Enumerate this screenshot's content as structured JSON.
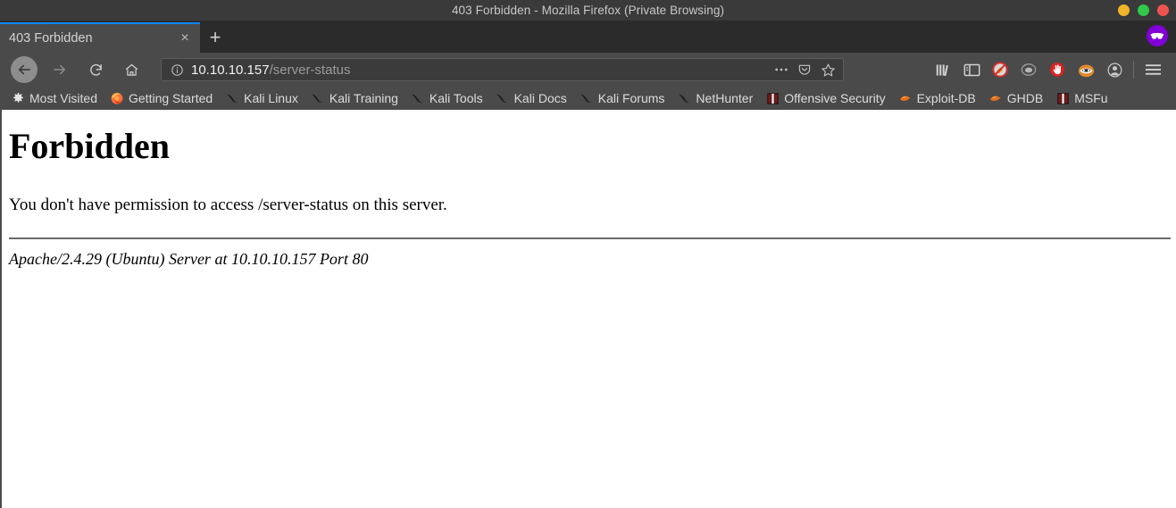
{
  "window": {
    "title": "403 Forbidden - Mozilla Firefox (Private Browsing)",
    "controls": [
      {
        "name": "minimize",
        "color": "#f0b429"
      },
      {
        "name": "maximize",
        "color": "#2fc84a"
      },
      {
        "name": "close",
        "color": "#ef5350"
      }
    ]
  },
  "tabbar": {
    "tabs": [
      {
        "title": "403 Forbidden",
        "close_label": "×",
        "active": true
      }
    ],
    "new_tab_label": "+",
    "private_badge": "private-browsing-mask"
  },
  "navbar": {
    "back_label": "back",
    "forward_label": "forward",
    "reload_label": "reload",
    "home_label": "home",
    "url": {
      "host": "10.10.10.157",
      "path": "/server-status",
      "identity_icon": "info-icon"
    },
    "url_actions": [
      {
        "name": "page-actions-icon",
        "label": "…"
      },
      {
        "name": "pocket-icon"
      },
      {
        "name": "bookmark-star-icon"
      }
    ],
    "toolbar_icons": [
      {
        "name": "library-icon"
      },
      {
        "name": "sidebar-icon"
      },
      {
        "name": "noscript-icon"
      },
      {
        "name": "extension-gray-icon"
      },
      {
        "name": "ublock-stop-icon"
      },
      {
        "name": "privacy-badger-icon"
      },
      {
        "name": "account-icon"
      },
      {
        "name": "menu-hamburger-icon"
      }
    ]
  },
  "bookmarks": {
    "items": [
      {
        "label": "Most Visited",
        "icon": "gear-icon"
      },
      {
        "label": "Getting Started",
        "icon": "firefox-icon"
      },
      {
        "label": "Kali Linux",
        "icon": "kali-dragon-icon"
      },
      {
        "label": "Kali Training",
        "icon": "kali-dragon-icon"
      },
      {
        "label": "Kali Tools",
        "icon": "kali-dragon-icon"
      },
      {
        "label": "Kali Docs",
        "icon": "kali-dragon-icon"
      },
      {
        "label": "Kali Forums",
        "icon": "kali-dragon-icon"
      },
      {
        "label": "NetHunter",
        "icon": "kali-dragon-icon"
      },
      {
        "label": "Offensive Security",
        "icon": "offsec-icon"
      },
      {
        "label": "Exploit-DB",
        "icon": "exploitdb-icon"
      },
      {
        "label": "GHDB",
        "icon": "exploitdb-icon"
      },
      {
        "label": "MSFu",
        "icon": "offsec-icon"
      }
    ]
  },
  "page": {
    "heading": "Forbidden",
    "message": "You don't have permission to access /server-status on this server.",
    "signature": "Apache/2.4.29 (Ubuntu) Server at 10.10.10.157 Port 80"
  },
  "colors": {
    "chrome_dark": "#2b2b2b",
    "chrome_mid": "#4a4a4a",
    "tab_accent": "#0a84ff",
    "private_purple": "#8000d7",
    "text_light": "#dcdcdc"
  }
}
